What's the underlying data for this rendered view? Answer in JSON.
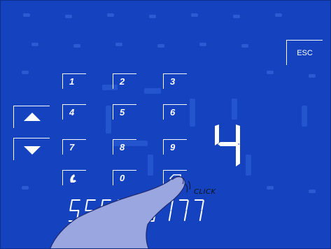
{
  "keypad": {
    "keys": [
      "1",
      "2",
      "3",
      "4",
      "5",
      "6",
      "7",
      "8",
      "9",
      "0"
    ],
    "phone_icon": "phone-handset-icon",
    "backspace_icon": "backspace-icon"
  },
  "esc_label": "ESC",
  "nav": {
    "up_icon": "triangle-up-icon",
    "down_icon": "triangle-down-icon"
  },
  "large_display": "4",
  "number_display": "555666777",
  "click_label": "CLICK",
  "colors": {
    "background": "#1543bf",
    "foreground": "#ffffff",
    "finger": "#9aa6e0"
  }
}
